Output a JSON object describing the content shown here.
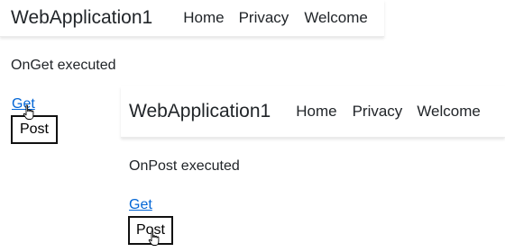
{
  "window_get": {
    "brand": "WebApplication1",
    "nav": {
      "home": "Home",
      "privacy": "Privacy",
      "welcome": "Welcome"
    },
    "status": "OnGet executed",
    "get_link": "Get",
    "post_button": "Post"
  },
  "window_post": {
    "brand": "WebApplication1",
    "nav": {
      "home": "Home",
      "privacy": "Privacy",
      "welcome": "Welcome"
    },
    "status": "OnPost executed",
    "get_link": "Get",
    "post_button": "Post"
  },
  "colors": {
    "link": "#0366d6",
    "text": "#212529"
  },
  "icons": {
    "cursor": "hand-pointer-cursor-icon"
  }
}
